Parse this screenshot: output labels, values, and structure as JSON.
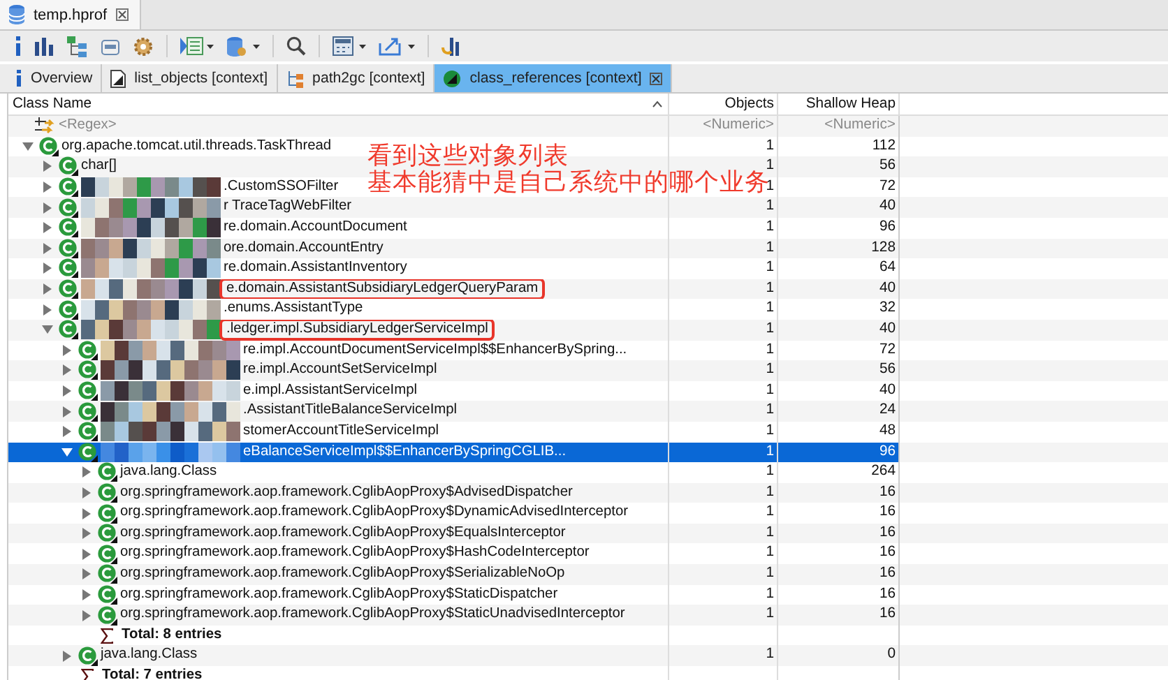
{
  "editor_tab": {
    "title": "temp.hprof"
  },
  "tabs": [
    {
      "label": "Overview",
      "kind": "overview",
      "selected": false
    },
    {
      "label": "list_objects [context]",
      "kind": "list",
      "selected": false
    },
    {
      "label": "path2gc [context]",
      "kind": "path",
      "selected": false
    },
    {
      "label": "class_references [context]",
      "kind": "references",
      "selected": true
    }
  ],
  "table": {
    "columns": [
      "Class Name",
      "Objects",
      "Shallow Heap"
    ],
    "filter_row": {
      "class_name": "<Regex>",
      "objects": "<Numeric>",
      "shallow_heap": "<Numeric>"
    },
    "rows": [
      {
        "kind": "class",
        "name": "org.apache.tomcat.util.threads.TaskThread",
        "objects": "1",
        "shallow_heap": "112",
        "expanded": true,
        "selected": false,
        "redacted": false,
        "highlighted": false,
        "children": [
          {
            "kind": "class",
            "name": "char[]",
            "objects": "1",
            "shallow_heap": "56",
            "expanded": false,
            "selected": false,
            "redacted": false,
            "highlighted": false
          },
          {
            "kind": "class",
            "name": ".CustomSSOFilter",
            "objects": "1",
            "shallow_heap": "72",
            "expanded": false,
            "selected": false,
            "redacted": true,
            "highlighted": false
          },
          {
            "kind": "class",
            "name": "r TraceTagWebFilter",
            "objects": "1",
            "shallow_heap": "40",
            "expanded": false,
            "selected": false,
            "redacted": true,
            "highlighted": false
          },
          {
            "kind": "class",
            "name": "re.domain.AccountDocument",
            "objects": "1",
            "shallow_heap": "96",
            "expanded": false,
            "selected": false,
            "redacted": true,
            "highlighted": false
          },
          {
            "kind": "class",
            "name": "ore.domain.AccountEntry",
            "objects": "1",
            "shallow_heap": "128",
            "expanded": false,
            "selected": false,
            "redacted": true,
            "highlighted": false
          },
          {
            "kind": "class",
            "name": "re.domain.AssistantInventory",
            "objects": "1",
            "shallow_heap": "64",
            "expanded": false,
            "selected": false,
            "redacted": true,
            "highlighted": false
          },
          {
            "kind": "class",
            "name": "e.domain.AssistantSubsidiaryLedgerQueryParam",
            "objects": "1",
            "shallow_heap": "40",
            "expanded": false,
            "selected": false,
            "redacted": true,
            "highlighted": true
          },
          {
            "kind": "class",
            "name": ".enums.AssistantType",
            "objects": "1",
            "shallow_heap": "32",
            "expanded": false,
            "selected": false,
            "redacted": true,
            "highlighted": false
          },
          {
            "kind": "class",
            "name": ".ledger.impl.SubsidiaryLedgerServiceImpl",
            "objects": "1",
            "shallow_heap": "40",
            "expanded": true,
            "selected": false,
            "redacted": true,
            "highlighted": true,
            "children": [
              {
                "kind": "class",
                "name": "re.impl.AccountDocumentServiceImpl$$EnhancerBySpring...",
                "objects": "1",
                "shallow_heap": "72",
                "expanded": false,
                "selected": false,
                "redacted": true,
                "highlighted": false
              },
              {
                "kind": "class",
                "name": "re.impl.AccountSetServiceImpl",
                "objects": "1",
                "shallow_heap": "56",
                "expanded": false,
                "selected": false,
                "redacted": true,
                "highlighted": false
              },
              {
                "kind": "class",
                "name": "e.impl.AssistantServiceImpl",
                "objects": "1",
                "shallow_heap": "40",
                "expanded": false,
                "selected": false,
                "redacted": true,
                "highlighted": false
              },
              {
                "kind": "class",
                "name": ".AssistantTitleBalanceServiceImpl",
                "objects": "1",
                "shallow_heap": "24",
                "expanded": false,
                "selected": false,
                "redacted": true,
                "highlighted": false
              },
              {
                "kind": "class",
                "name": "stomerAccountTitleServiceImpl",
                "objects": "1",
                "shallow_heap": "48",
                "expanded": false,
                "selected": false,
                "redacted": true,
                "highlighted": false
              },
              {
                "kind": "class",
                "name": "eBalanceServiceImpl$$EnhancerBySpringCGLIB...",
                "objects": "1",
                "shallow_heap": "96",
                "expanded": true,
                "selected": true,
                "redacted": true,
                "highlighted": false,
                "children": [
                  {
                    "kind": "class",
                    "name": "java.lang.Class",
                    "objects": "1",
                    "shallow_heap": "264",
                    "expanded": false,
                    "selected": false,
                    "redacted": false,
                    "highlighted": false
                  },
                  {
                    "kind": "class",
                    "name": "org.springframework.aop.framework.CglibAopProxy$AdvisedDispatcher",
                    "objects": "1",
                    "shallow_heap": "16",
                    "expanded": false,
                    "selected": false,
                    "redacted": false,
                    "highlighted": false
                  },
                  {
                    "kind": "class",
                    "name": "org.springframework.aop.framework.CglibAopProxy$DynamicAdvisedInterceptor",
                    "objects": "1",
                    "shallow_heap": "16",
                    "expanded": false,
                    "selected": false,
                    "redacted": false,
                    "highlighted": false
                  },
                  {
                    "kind": "class",
                    "name": "org.springframework.aop.framework.CglibAopProxy$EqualsInterceptor",
                    "objects": "1",
                    "shallow_heap": "16",
                    "expanded": false,
                    "selected": false,
                    "redacted": false,
                    "highlighted": false
                  },
                  {
                    "kind": "class",
                    "name": "org.springframework.aop.framework.CglibAopProxy$HashCodeInterceptor",
                    "objects": "1",
                    "shallow_heap": "16",
                    "expanded": false,
                    "selected": false,
                    "redacted": false,
                    "highlighted": false
                  },
                  {
                    "kind": "class",
                    "name": "org.springframework.aop.framework.CglibAopProxy$SerializableNoOp",
                    "objects": "1",
                    "shallow_heap": "16",
                    "expanded": false,
                    "selected": false,
                    "redacted": false,
                    "highlighted": false
                  },
                  {
                    "kind": "class",
                    "name": "org.springframework.aop.framework.CglibAopProxy$StaticDispatcher",
                    "objects": "1",
                    "shallow_heap": "16",
                    "expanded": false,
                    "selected": false,
                    "redacted": false,
                    "highlighted": false
                  },
                  {
                    "kind": "class",
                    "name": "org.springframework.aop.framework.CglibAopProxy$StaticUnadvisedInterceptor",
                    "objects": "1",
                    "shallow_heap": "16",
                    "expanded": false,
                    "selected": false,
                    "redacted": false,
                    "highlighted": false
                  },
                  {
                    "kind": "total",
                    "name": "Total: 8 entries"
                  }
                ]
              },
              {
                "kind": "class",
                "name": "java.lang.Class",
                "objects": "1",
                "shallow_heap": "0",
                "expanded": false,
                "selected": false,
                "redacted": false,
                "highlighted": false
              },
              {
                "kind": "total",
                "name": "Total: 7 entries"
              }
            ]
          }
        ]
      }
    ]
  },
  "annotation": {
    "lines": [
      "看到这些对象列表",
      "基本能猜中是自己系统中的哪个业务"
    ]
  }
}
